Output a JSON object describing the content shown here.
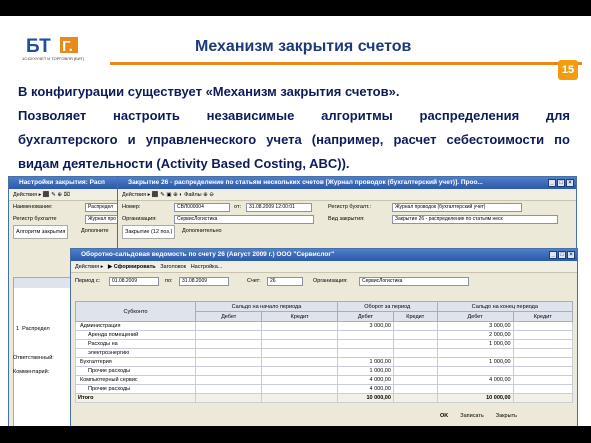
{
  "logo": {
    "mark": "БТ",
    "sub": "1С:БУХУЧЕТ И ТОРГОВЛЯ (БИТ)"
  },
  "slide": {
    "title": "Механизм закрытия счетов",
    "number": "15",
    "text_line1": "В конфигурации существует «Механизм закрытия счетов».",
    "text_line2_words": [
      "Позволяет",
      "настроить",
      "независимые",
      "алгоритмы",
      "распределения",
      "для"
    ],
    "text_line3_words": [
      "бухгалтерского",
      "и",
      "управленческого",
      "учета",
      "(например,",
      "расчет",
      "себестоимости",
      "по"
    ],
    "text_line4": "видам деятельности (Activity Based Costing, ABC))."
  },
  "win1": {
    "title": "Настройки закрытия: Расп",
    "toolbar": "Действия ▸  ⬛ ✎ ⊕ ⌧",
    "name_label": "Наименование:",
    "name_value": "Распредел",
    "register_label": "Регистр бухгалте",
    "register_value": "Журнал про",
    "tab1": "Алгоритм закрытия",
    "tab2": "Дополните",
    "row_num": "1",
    "row_value": "Распредел",
    "resp_label": "Ответственный:",
    "comment_label": "Комментарий:"
  },
  "win2": {
    "title": "Закрытие 26 - распределение по статьям нескольких счетов [Журнал проводок (бухгалтерский учет)]. Проо...",
    "toolbar": "Действия ▸  ⬛ ✎ ▣ ⊕  ◐ Файлы  ⊕ ⊖",
    "number_label": "Номер:",
    "number_value": "СВЛ000004",
    "date_label": "от:",
    "date_value": "31.08.2009 12:00:01",
    "reg_label": "Регистр бухгалт.:",
    "reg_value": "Журнал проводок (бухгалтерский учет)",
    "org_label": "Организация:",
    "org_value": "СервисЛогистика",
    "type_label": "Вид закрытия:",
    "type_value": "Закрытие 26 - распределение по статьям неск",
    "tab1": "Закрытие (12 поз.)",
    "tab2": "Дополнительно"
  },
  "win3": {
    "title": "Оборотно-сальдовая ведомость по счету 26 (Август 2009 г.) ООО \"Сервислог\"",
    "toolbar_actions": "Действия ▸",
    "toolbar_generate": "▶ Сформировать",
    "toolbar_header": "Заголовок",
    "toolbar_settings": "Настройка...",
    "period_label": "Период с:",
    "period_from": "01.08.2009",
    "period_to_label": "по:",
    "period_to": "31.08.2009",
    "account_label": "Счет:",
    "account_value": "26",
    "org_label": "Организация:",
    "org_value": "СервисЛогистика",
    "headers": [
      "Субконто",
      "Сальдо на начало периода",
      "Оборот за период",
      "Сальдо на конец периода"
    ],
    "subheaders": [
      "Дебет",
      "Кредит",
      "Дебет",
      "Кредит",
      "Дебет",
      "Кредит"
    ],
    "rows": [
      {
        "name": "Администрация",
        "indent": 0,
        "d2": "3 000,00",
        "c2": "",
        "d3": "3 000,00",
        "c3": ""
      },
      {
        "name": "Аренда помещений",
        "indent": 1,
        "d2": "",
        "c2": "",
        "d3": "2 000,00",
        "c3": ""
      },
      {
        "name": "Расходы на",
        "indent": 1,
        "d2": "",
        "c2": "",
        "d3": "1 000,00",
        "c3": ""
      },
      {
        "name": "электроэнергию",
        "indent": 1,
        "d2": "",
        "c2": "",
        "d3": "",
        "c3": ""
      },
      {
        "name": "Бухгалтерия",
        "indent": 0,
        "d2": "1 000,00",
        "c2": "",
        "d3": "1 000,00",
        "c3": ""
      },
      {
        "name": "Прочие расходы",
        "indent": 1,
        "d2": "1 000,00",
        "c2": "",
        "d3": "",
        "c3": ""
      },
      {
        "name": "Компьютерный сервис",
        "indent": 0,
        "d2": "4 000,00",
        "c2": "",
        "d3": "4 000,00",
        "c3": ""
      },
      {
        "name": "Прочие расходы",
        "indent": 1,
        "d2": "4 000,00",
        "c2": "",
        "d3": "",
        "c3": ""
      }
    ],
    "total": {
      "name": "Итого",
      "d2": "10 000,00",
      "c2": "",
      "d3": "10 000,00",
      "c3": ""
    }
  },
  "bottom_bar": {
    "ok": "OK",
    "save": "Записать",
    "close": "Закрыть"
  }
}
